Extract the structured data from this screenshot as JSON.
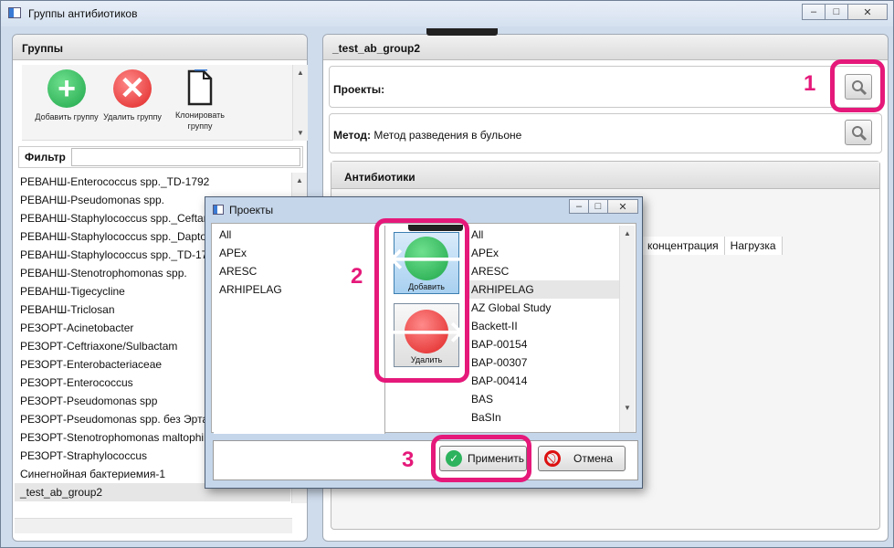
{
  "window": {
    "title": "Группы антибиотиков",
    "minimize": "–",
    "maximize": "□",
    "close": "✕"
  },
  "left": {
    "header": "Группы",
    "toolbar": [
      {
        "label": "Добавить группу",
        "icon": "add-icon"
      },
      {
        "label": "Удалить группу",
        "icon": "delete-icon"
      },
      {
        "label": "Клонировать группу",
        "icon": "clone-icon"
      }
    ],
    "filter_label": "Фильтр",
    "filter_value": "",
    "groups": [
      "РЕВАНШ-Enterococcus spp._TD-1792",
      "РЕВАНШ-Pseudomonas spp.",
      "РЕВАНШ-Staphylococcus spp._Ceftaroline",
      "РЕВАНШ-Staphylococcus spp._Daptomycin",
      "РЕВАНШ-Staphylococcus spp._TD-1792",
      "РЕВАНШ-Stenotrophomonas spp.",
      "РЕВАНШ-Tigecycline",
      "РЕВАНШ-Triclosan",
      "РЕЗОРТ-Acinetobacter",
      "РЕЗОРТ-Ceftriaxone/Sulbactam",
      "РЕЗОРТ-Enterobacteriaceae",
      "РЕЗОРТ-Enterococcus",
      "РЕЗОРТ-Pseudomonas spp",
      "РЕЗОРТ-Pseudomonas spp. без Эртапенема",
      "РЕЗОРТ-Stenotrophomonas maltophilia",
      "РЕЗОРТ-Straphylococcus",
      "Синегнойная бактериемия-1",
      "_test_ab_group2"
    ],
    "selected_group": "_test_ab_group2"
  },
  "right": {
    "header": "_test_ab_group2",
    "projects_label": "Проекты:",
    "method_label": "Метод:",
    "method_value": "Метод разведения в бульоне",
    "antibiotics_header": "Антибиотики",
    "columns": [
      "концентрация",
      "Нагрузка"
    ]
  },
  "dialog": {
    "title": "Проекты",
    "left_items": [
      "All",
      "APEx",
      "ARESC",
      "ARHIPELAG"
    ],
    "right_items": [
      "All",
      "APEx",
      "ARESC",
      "ARHIPELAG",
      "AZ Global Study",
      "Backett-II",
      "BAP-00154",
      "BAP-00307",
      "BAP-00414",
      "BAS",
      "BaSIn"
    ],
    "selected_right": "ARHIPELAG",
    "add_label": "Добавить",
    "remove_label": "Удалить",
    "apply_label": "Применить",
    "cancel_label": "Отмена"
  },
  "annotations": [
    "1",
    "2",
    "3"
  ],
  "colors": {
    "highlight": "#e5197a",
    "add": "#2db35d",
    "remove": "#e53535",
    "window_bg": "#cfdcec"
  }
}
